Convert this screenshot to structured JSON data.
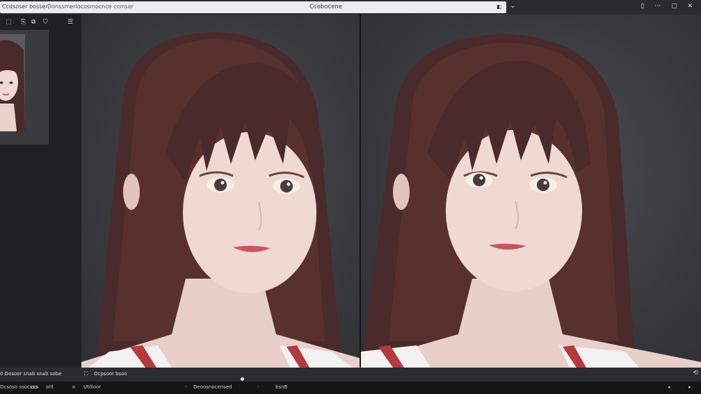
{
  "topbar": {
    "left_label": "Ccdsoser",
    "left_label_2": "bosser",
    "address_text": "Donssmerlocosmocnce ccmser",
    "title": "Ccobocene",
    "url_button": "◧",
    "chevron": "⌄",
    "right_icons": "▯ ⋯ ▢ ✕"
  },
  "sidebar": {
    "toolbar_icons": [
      "⬚",
      "⎘",
      "⧉",
      "⛉",
      "☰"
    ]
  },
  "bottom": {
    "sidebar_text": "0   Dosoor snab snab sobe",
    "zoom_icon": "⛶",
    "status_text": "Ocpsoor bsoo",
    "corner_icon": "⟲"
  },
  "statusbar": {
    "items": [
      "Ocsoso ssocsss",
      "ccs",
      "snt",
      "o",
      "Utilloor",
      "·",
      "Deoosnocensed",
      "·",
      "bsnB",
      "◂",
      "▸"
    ]
  },
  "colors": {
    "hair": "#4a2a2a",
    "skin": "#efd9d2",
    "background": "#3f4044"
  }
}
